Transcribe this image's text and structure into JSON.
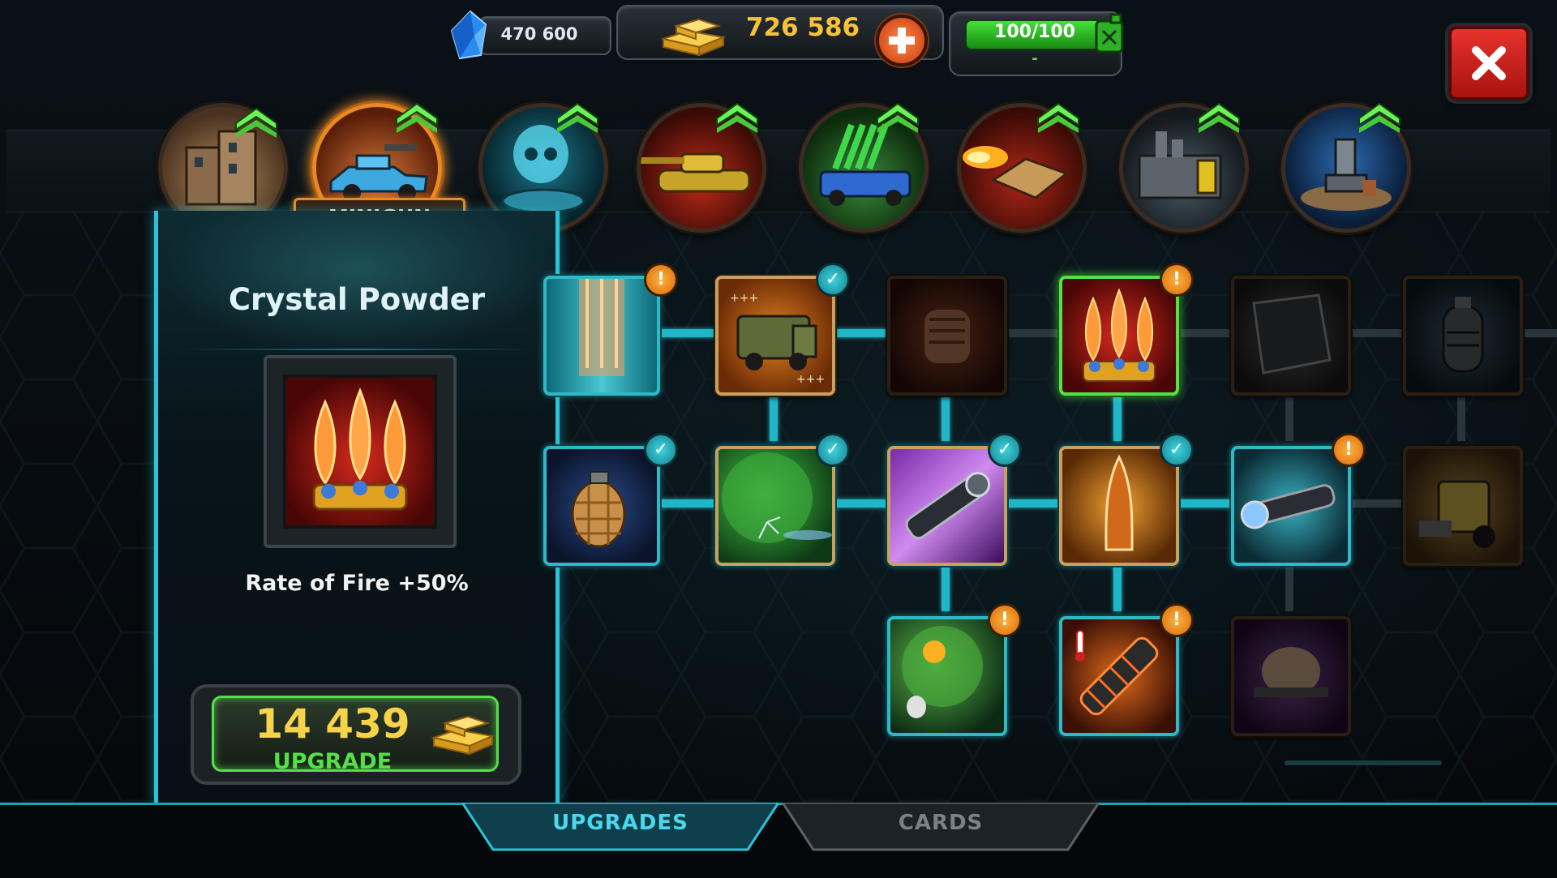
{
  "resources": {
    "crystals": "470 600",
    "gold": "726 586",
    "fuel": "100/100",
    "fuel_sub": "-"
  },
  "categories": [
    {
      "name": "building-vehicle"
    },
    {
      "name": "minigun-truck",
      "label": "MINIGUN",
      "selected": true
    },
    {
      "name": "hologram-skull"
    },
    {
      "name": "tank"
    },
    {
      "name": "rocket-truck"
    },
    {
      "name": "flame-bunker"
    },
    {
      "name": "factory"
    },
    {
      "name": "drill-station"
    }
  ],
  "item": {
    "title": "Crystal Powder",
    "effect": "Rate of Fire +50%",
    "cost": "14 439",
    "upgrade_label": "UPGRADE"
  },
  "tree": {
    "row1": [
      {
        "name": "armor-plate-node",
        "badge": "warn"
      },
      {
        "name": "armored-truck-node",
        "badge": "ok"
      },
      {
        "name": "fist-node",
        "badge": "none"
      },
      {
        "name": "crystal-powder-node",
        "badge": "warn",
        "selected": true
      },
      {
        "name": "steel-plate-node",
        "badge": "none"
      },
      {
        "name": "grenade-canister-node",
        "badge": "none"
      }
    ],
    "row2": [
      {
        "name": "frag-grenade-node",
        "badge": "ok"
      },
      {
        "name": "green-shield-node",
        "badge": "ok"
      },
      {
        "name": "minigun-barrel-node",
        "badge": "ok"
      },
      {
        "name": "bullet-node",
        "badge": "ok"
      },
      {
        "name": "scope-node",
        "badge": "warn"
      },
      {
        "name": "bulldozer-node",
        "badge": "none"
      }
    ],
    "row3": [
      {
        "name": "grenade-shield-node",
        "badge": "warn"
      },
      {
        "name": "heated-barrel-node",
        "badge": "warn"
      },
      {
        "name": "muscle-node",
        "badge": "none"
      }
    ]
  },
  "tabs": {
    "upgrades": "UPGRADES",
    "cards": "CARDS"
  },
  "colors": {
    "teal": "#2ac3d8",
    "gold": "#f6c23a",
    "green": "#55e04a",
    "orange": "#e88a22",
    "close_red": "#d11f1f"
  },
  "icons": [
    "crystal-icon",
    "gold-bars-icon",
    "plus-icon",
    "fuel-can-icon",
    "close-icon",
    "upgrade-chevron-icon",
    "check-icon",
    "exclamation-icon"
  ]
}
